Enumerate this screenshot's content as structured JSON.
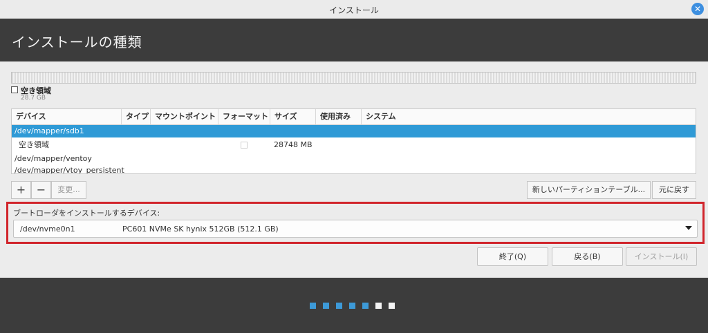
{
  "window": {
    "title": "インストール",
    "close_glyph": "✕"
  },
  "header": {
    "title": "インストールの種類"
  },
  "legend": {
    "name": "空き領域",
    "size": "28.7 GB"
  },
  "table": {
    "columns": [
      "デバイス",
      "タイプ",
      "マウントポイント",
      "フォーマット",
      "サイズ",
      "使用済み",
      "システム"
    ],
    "rows": [
      {
        "device": "/dev/mapper/sdb1",
        "size": "",
        "selected": true
      },
      {
        "device": "空き領域",
        "size": "28748 MB",
        "selected": false
      },
      {
        "device": "/dev/mapper/ventoy",
        "size": "",
        "selected": false
      },
      {
        "device": "/dev/mapper/vtoy_persistent",
        "size": "",
        "selected": false
      }
    ]
  },
  "toolbar": {
    "add_label": "+",
    "remove_label": "−",
    "change_label": "変更...",
    "new_table_label": "新しいパーティションテーブル...",
    "revert_label": "元に戻す"
  },
  "bootloader": {
    "label": "ブートローダをインストールするデバイス:",
    "device": "/dev/nvme0n1",
    "description": "PC601 NVMe SK hynix 512GB (512.1 GB)"
  },
  "nav": {
    "quit_label": "終了(Q)",
    "back_label": "戻る(B)",
    "install_label": "インストール(I)"
  },
  "progress": {
    "steps_total": 7,
    "steps_done": 5
  },
  "colors": {
    "accent": "#2f9ad6",
    "highlight_border": "#d1242b",
    "header_bg": "#3c3c3c"
  }
}
